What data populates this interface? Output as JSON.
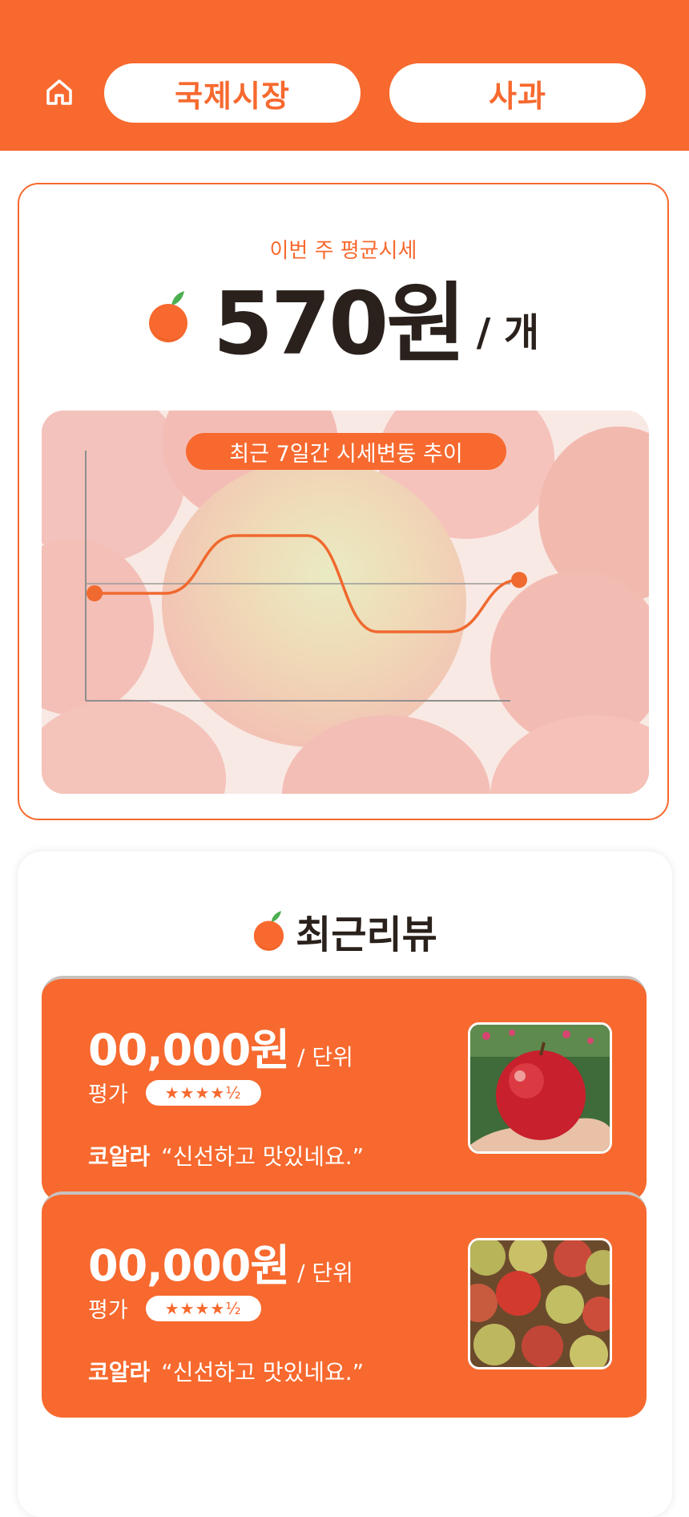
{
  "header": {
    "home_icon": "home-icon",
    "market_button": "국제시장",
    "product_button": "사과"
  },
  "price_card": {
    "caption": "이번 주 평균시세",
    "icon": "orange-fruit-icon",
    "price": "570원",
    "unit": "/ 개"
  },
  "trend_chart": {
    "title": "최근 7일간 시세변동 추이",
    "background": "apple-photo",
    "chart_data": {
      "type": "line",
      "title": "최근 7일간 시세변동 추이",
      "xlabel": "",
      "ylabel": "",
      "series": [
        {
          "values": [
            560,
            560,
            590,
            590,
            540,
            540,
            567
          ]
        }
      ],
      "ylim": [
        500,
        630
      ],
      "reference_line": 565,
      "grid": false
    }
  },
  "reviews": {
    "icon": "orange-fruit-icon",
    "title": "최근리뷰",
    "items": [
      {
        "price": "00,000원",
        "unit": "/ 단위",
        "rating_label": "평가",
        "stars": "★★★★½",
        "rating": 4.5,
        "author": "코알라",
        "comment": "“신선하고 맛있네요.”",
        "photo": "single-red-apple-in-hand"
      },
      {
        "price": "00,000원",
        "unit": "/ 단위",
        "rating_label": "평가",
        "stars": "★★★★½",
        "rating": 4.5,
        "author": "코알라",
        "comment": "“신선하고 맛있네요.”",
        "photo": "basket-of-apples"
      }
    ]
  },
  "colors": {
    "accent": "#f7692e",
    "text_dark": "#2a211c",
    "chart_line": "#f0692e"
  }
}
